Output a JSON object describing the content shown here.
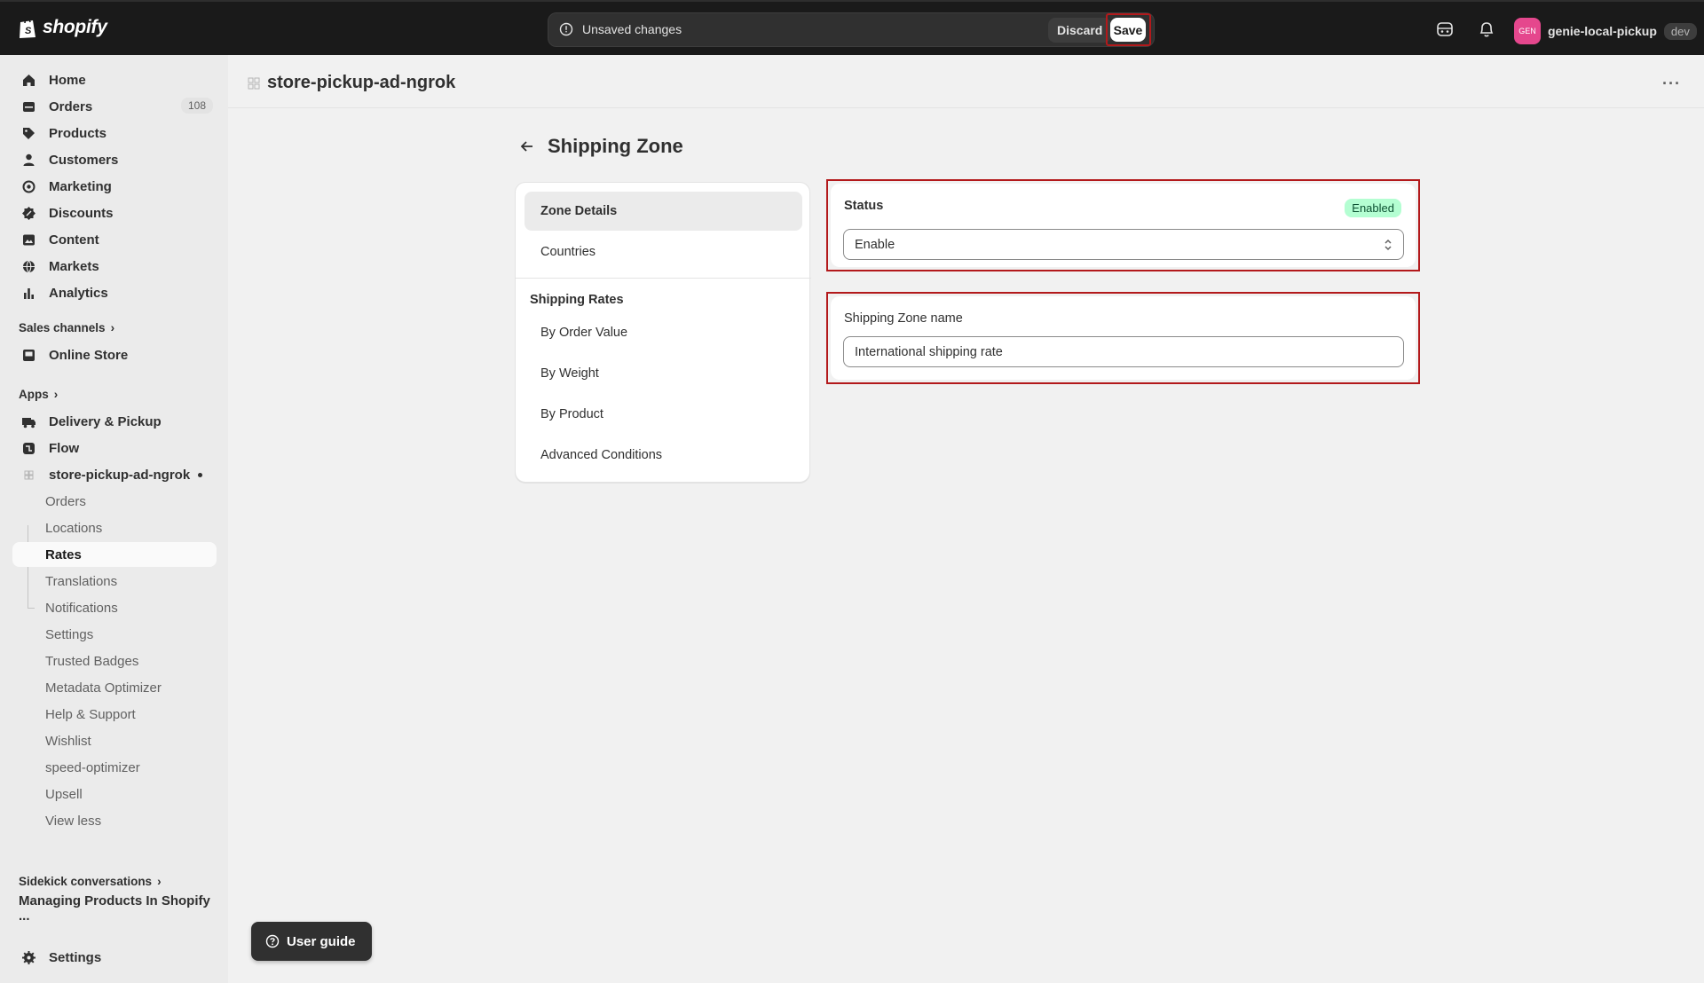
{
  "topbar": {
    "brand": "shopify",
    "unsaved_message": "Unsaved changes",
    "discard_label": "Discard",
    "save_label": "Save",
    "avatar_initials": "GEN",
    "store_name": "genie-local-pickup",
    "env_badge": "dev"
  },
  "sidebar": {
    "main_items": [
      {
        "label": "Home",
        "icon": "home-icon"
      },
      {
        "label": "Orders",
        "icon": "orders-icon",
        "count": "108"
      },
      {
        "label": "Products",
        "icon": "tag-icon"
      },
      {
        "label": "Customers",
        "icon": "person-icon"
      },
      {
        "label": "Marketing",
        "icon": "target-icon"
      },
      {
        "label": "Discounts",
        "icon": "discount-icon"
      },
      {
        "label": "Content",
        "icon": "image-icon"
      },
      {
        "label": "Markets",
        "icon": "globe-icon"
      },
      {
        "label": "Analytics",
        "icon": "bar-chart-icon"
      }
    ],
    "sales_channels_label": "Sales channels",
    "online_store_label": "Online Store",
    "apps_label": "Apps",
    "apps": [
      {
        "label": "Delivery & Pickup"
      },
      {
        "label": "Flow"
      },
      {
        "label": "store-pickup-ad-ngrok"
      }
    ],
    "sub_items": [
      "Orders",
      "Locations",
      "Rates",
      "Translations",
      "Notifications",
      "Settings",
      "Trusted Badges",
      "Metadata Optimizer",
      "Help & Support",
      "Wishlist",
      "speed-optimizer",
      "Upsell",
      "View less"
    ],
    "sidekick_label": "Sidekick conversations",
    "conversation": "Managing Products In Shopify ...",
    "settings_label": "Settings"
  },
  "header": {
    "app_title": "store-pickup-ad-ngrok",
    "more": "···"
  },
  "page": {
    "title": "Shipping Zone",
    "nav": {
      "zone_details": "Zone Details",
      "countries": "Countries",
      "shipping_rates_heading": "Shipping Rates",
      "by_order_value": "By Order Value",
      "by_weight": "By Weight",
      "by_product": "By Product",
      "advanced_conditions": "Advanced Conditions"
    },
    "status": {
      "label": "Status",
      "badge": "Enabled",
      "selected": "Enable"
    },
    "zone_name": {
      "label": "Shipping Zone name",
      "value": "International shipping rate"
    }
  },
  "user_guide_label": "User guide",
  "colors": {
    "highlight": "#b3191b",
    "topbar": "#1a1a1a",
    "badge_success": "#b4fed2"
  }
}
